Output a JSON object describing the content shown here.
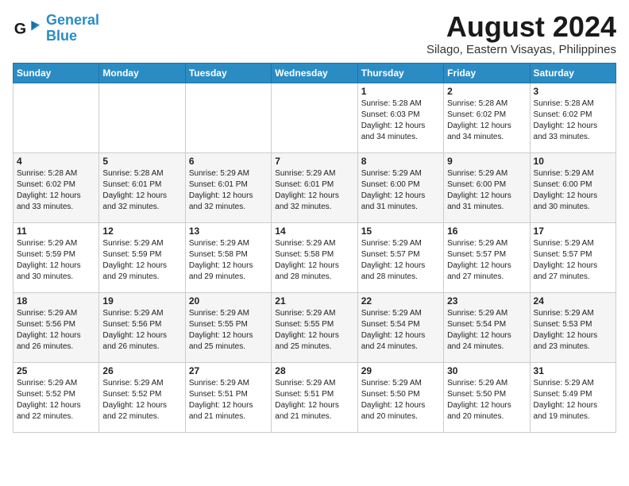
{
  "header": {
    "logo_line1": "General",
    "logo_line2": "Blue",
    "month_year": "August 2024",
    "location": "Silago, Eastern Visayas, Philippines"
  },
  "days_of_week": [
    "Sunday",
    "Monday",
    "Tuesday",
    "Wednesday",
    "Thursday",
    "Friday",
    "Saturday"
  ],
  "weeks": [
    [
      {
        "day": "",
        "sunrise": "",
        "sunset": "",
        "daylight": ""
      },
      {
        "day": "",
        "sunrise": "",
        "sunset": "",
        "daylight": ""
      },
      {
        "day": "",
        "sunrise": "",
        "sunset": "",
        "daylight": ""
      },
      {
        "day": "",
        "sunrise": "",
        "sunset": "",
        "daylight": ""
      },
      {
        "day": "1",
        "sunrise": "Sunrise: 5:28 AM",
        "sunset": "Sunset: 6:03 PM",
        "daylight": "Daylight: 12 hours and 34 minutes."
      },
      {
        "day": "2",
        "sunrise": "Sunrise: 5:28 AM",
        "sunset": "Sunset: 6:02 PM",
        "daylight": "Daylight: 12 hours and 34 minutes."
      },
      {
        "day": "3",
        "sunrise": "Sunrise: 5:28 AM",
        "sunset": "Sunset: 6:02 PM",
        "daylight": "Daylight: 12 hours and 33 minutes."
      }
    ],
    [
      {
        "day": "4",
        "sunrise": "Sunrise: 5:28 AM",
        "sunset": "Sunset: 6:02 PM",
        "daylight": "Daylight: 12 hours and 33 minutes."
      },
      {
        "day": "5",
        "sunrise": "Sunrise: 5:28 AM",
        "sunset": "Sunset: 6:01 PM",
        "daylight": "Daylight: 12 hours and 32 minutes."
      },
      {
        "day": "6",
        "sunrise": "Sunrise: 5:29 AM",
        "sunset": "Sunset: 6:01 PM",
        "daylight": "Daylight: 12 hours and 32 minutes."
      },
      {
        "day": "7",
        "sunrise": "Sunrise: 5:29 AM",
        "sunset": "Sunset: 6:01 PM",
        "daylight": "Daylight: 12 hours and 32 minutes."
      },
      {
        "day": "8",
        "sunrise": "Sunrise: 5:29 AM",
        "sunset": "Sunset: 6:00 PM",
        "daylight": "Daylight: 12 hours and 31 minutes."
      },
      {
        "day": "9",
        "sunrise": "Sunrise: 5:29 AM",
        "sunset": "Sunset: 6:00 PM",
        "daylight": "Daylight: 12 hours and 31 minutes."
      },
      {
        "day": "10",
        "sunrise": "Sunrise: 5:29 AM",
        "sunset": "Sunset: 6:00 PM",
        "daylight": "Daylight: 12 hours and 30 minutes."
      }
    ],
    [
      {
        "day": "11",
        "sunrise": "Sunrise: 5:29 AM",
        "sunset": "Sunset: 5:59 PM",
        "daylight": "Daylight: 12 hours and 30 minutes."
      },
      {
        "day": "12",
        "sunrise": "Sunrise: 5:29 AM",
        "sunset": "Sunset: 5:59 PM",
        "daylight": "Daylight: 12 hours and 29 minutes."
      },
      {
        "day": "13",
        "sunrise": "Sunrise: 5:29 AM",
        "sunset": "Sunset: 5:58 PM",
        "daylight": "Daylight: 12 hours and 29 minutes."
      },
      {
        "day": "14",
        "sunrise": "Sunrise: 5:29 AM",
        "sunset": "Sunset: 5:58 PM",
        "daylight": "Daylight: 12 hours and 28 minutes."
      },
      {
        "day": "15",
        "sunrise": "Sunrise: 5:29 AM",
        "sunset": "Sunset: 5:57 PM",
        "daylight": "Daylight: 12 hours and 28 minutes."
      },
      {
        "day": "16",
        "sunrise": "Sunrise: 5:29 AM",
        "sunset": "Sunset: 5:57 PM",
        "daylight": "Daylight: 12 hours and 27 minutes."
      },
      {
        "day": "17",
        "sunrise": "Sunrise: 5:29 AM",
        "sunset": "Sunset: 5:57 PM",
        "daylight": "Daylight: 12 hours and 27 minutes."
      }
    ],
    [
      {
        "day": "18",
        "sunrise": "Sunrise: 5:29 AM",
        "sunset": "Sunset: 5:56 PM",
        "daylight": "Daylight: 12 hours and 26 minutes."
      },
      {
        "day": "19",
        "sunrise": "Sunrise: 5:29 AM",
        "sunset": "Sunset: 5:56 PM",
        "daylight": "Daylight: 12 hours and 26 minutes."
      },
      {
        "day": "20",
        "sunrise": "Sunrise: 5:29 AM",
        "sunset": "Sunset: 5:55 PM",
        "daylight": "Daylight: 12 hours and 25 minutes."
      },
      {
        "day": "21",
        "sunrise": "Sunrise: 5:29 AM",
        "sunset": "Sunset: 5:55 PM",
        "daylight": "Daylight: 12 hours and 25 minutes."
      },
      {
        "day": "22",
        "sunrise": "Sunrise: 5:29 AM",
        "sunset": "Sunset: 5:54 PM",
        "daylight": "Daylight: 12 hours and 24 minutes."
      },
      {
        "day": "23",
        "sunrise": "Sunrise: 5:29 AM",
        "sunset": "Sunset: 5:54 PM",
        "daylight": "Daylight: 12 hours and 24 minutes."
      },
      {
        "day": "24",
        "sunrise": "Sunrise: 5:29 AM",
        "sunset": "Sunset: 5:53 PM",
        "daylight": "Daylight: 12 hours and 23 minutes."
      }
    ],
    [
      {
        "day": "25",
        "sunrise": "Sunrise: 5:29 AM",
        "sunset": "Sunset: 5:52 PM",
        "daylight": "Daylight: 12 hours and 22 minutes."
      },
      {
        "day": "26",
        "sunrise": "Sunrise: 5:29 AM",
        "sunset": "Sunset: 5:52 PM",
        "daylight": "Daylight: 12 hours and 22 minutes."
      },
      {
        "day": "27",
        "sunrise": "Sunrise: 5:29 AM",
        "sunset": "Sunset: 5:51 PM",
        "daylight": "Daylight: 12 hours and 21 minutes."
      },
      {
        "day": "28",
        "sunrise": "Sunrise: 5:29 AM",
        "sunset": "Sunset: 5:51 PM",
        "daylight": "Daylight: 12 hours and 21 minutes."
      },
      {
        "day": "29",
        "sunrise": "Sunrise: 5:29 AM",
        "sunset": "Sunset: 5:50 PM",
        "daylight": "Daylight: 12 hours and 20 minutes."
      },
      {
        "day": "30",
        "sunrise": "Sunrise: 5:29 AM",
        "sunset": "Sunset: 5:50 PM",
        "daylight": "Daylight: 12 hours and 20 minutes."
      },
      {
        "day": "31",
        "sunrise": "Sunrise: 5:29 AM",
        "sunset": "Sunset: 5:49 PM",
        "daylight": "Daylight: 12 hours and 19 minutes."
      }
    ]
  ]
}
